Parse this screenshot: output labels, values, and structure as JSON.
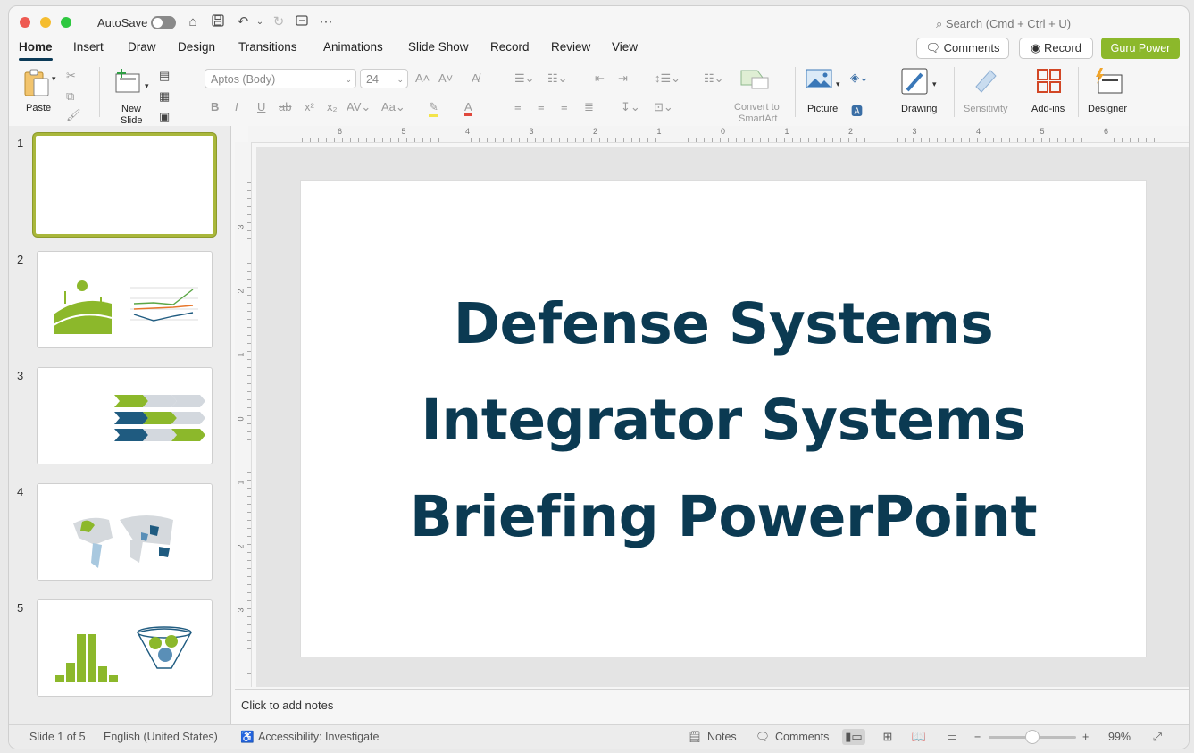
{
  "titlebar": {
    "autosave_label": "AutoSave",
    "search_placeholder": "Search (Cmd + Ctrl + U)"
  },
  "tabs": [
    "Home",
    "Insert",
    "Draw",
    "Design",
    "Transitions",
    "Animations",
    "Slide Show",
    "Record",
    "Review",
    "View"
  ],
  "actions": {
    "comments": "Comments",
    "record": "Record",
    "guru": "Guru Power"
  },
  "ribbon": {
    "paste": "Paste",
    "new_slide_line1": "New",
    "new_slide_line2": "Slide",
    "font": "Aptos (Body)",
    "size": "24",
    "convert_line1": "Convert to",
    "convert_line2": "SmartArt",
    "picture": "Picture",
    "drawing": "Drawing",
    "sensitivity": "Sensitivity",
    "addins": "Add-ins",
    "designer": "Designer"
  },
  "slides": [
    {
      "number": "1"
    },
    {
      "number": "2"
    },
    {
      "number": "3"
    },
    {
      "number": "4"
    },
    {
      "number": "5"
    }
  ],
  "current_slide": {
    "title_lines": [
      "Defense Systems",
      "Integrator Systems",
      "Briefing PowerPoint"
    ]
  },
  "ruler": {
    "h_labels": [
      "6",
      "5",
      "4",
      "3",
      "2",
      "1",
      "0",
      "1",
      "2",
      "3",
      "4",
      "5",
      "6"
    ],
    "v_labels": [
      "3",
      "2",
      "1",
      "0",
      "1",
      "2",
      "3"
    ]
  },
  "notes_placeholder": "Click to add notes",
  "status": {
    "slide_info": "Slide 1 of 5",
    "language": "English (United States)",
    "accessibility": "Accessibility: Investigate",
    "notes": "Notes",
    "comments": "Comments",
    "zoom": "99%",
    "zoom_fraction": 0.5
  },
  "colors": {
    "accent": "#8cb82b",
    "title": "#0b3a52",
    "dark_blue": "#1f5b80",
    "selection": "#a9b73b"
  }
}
